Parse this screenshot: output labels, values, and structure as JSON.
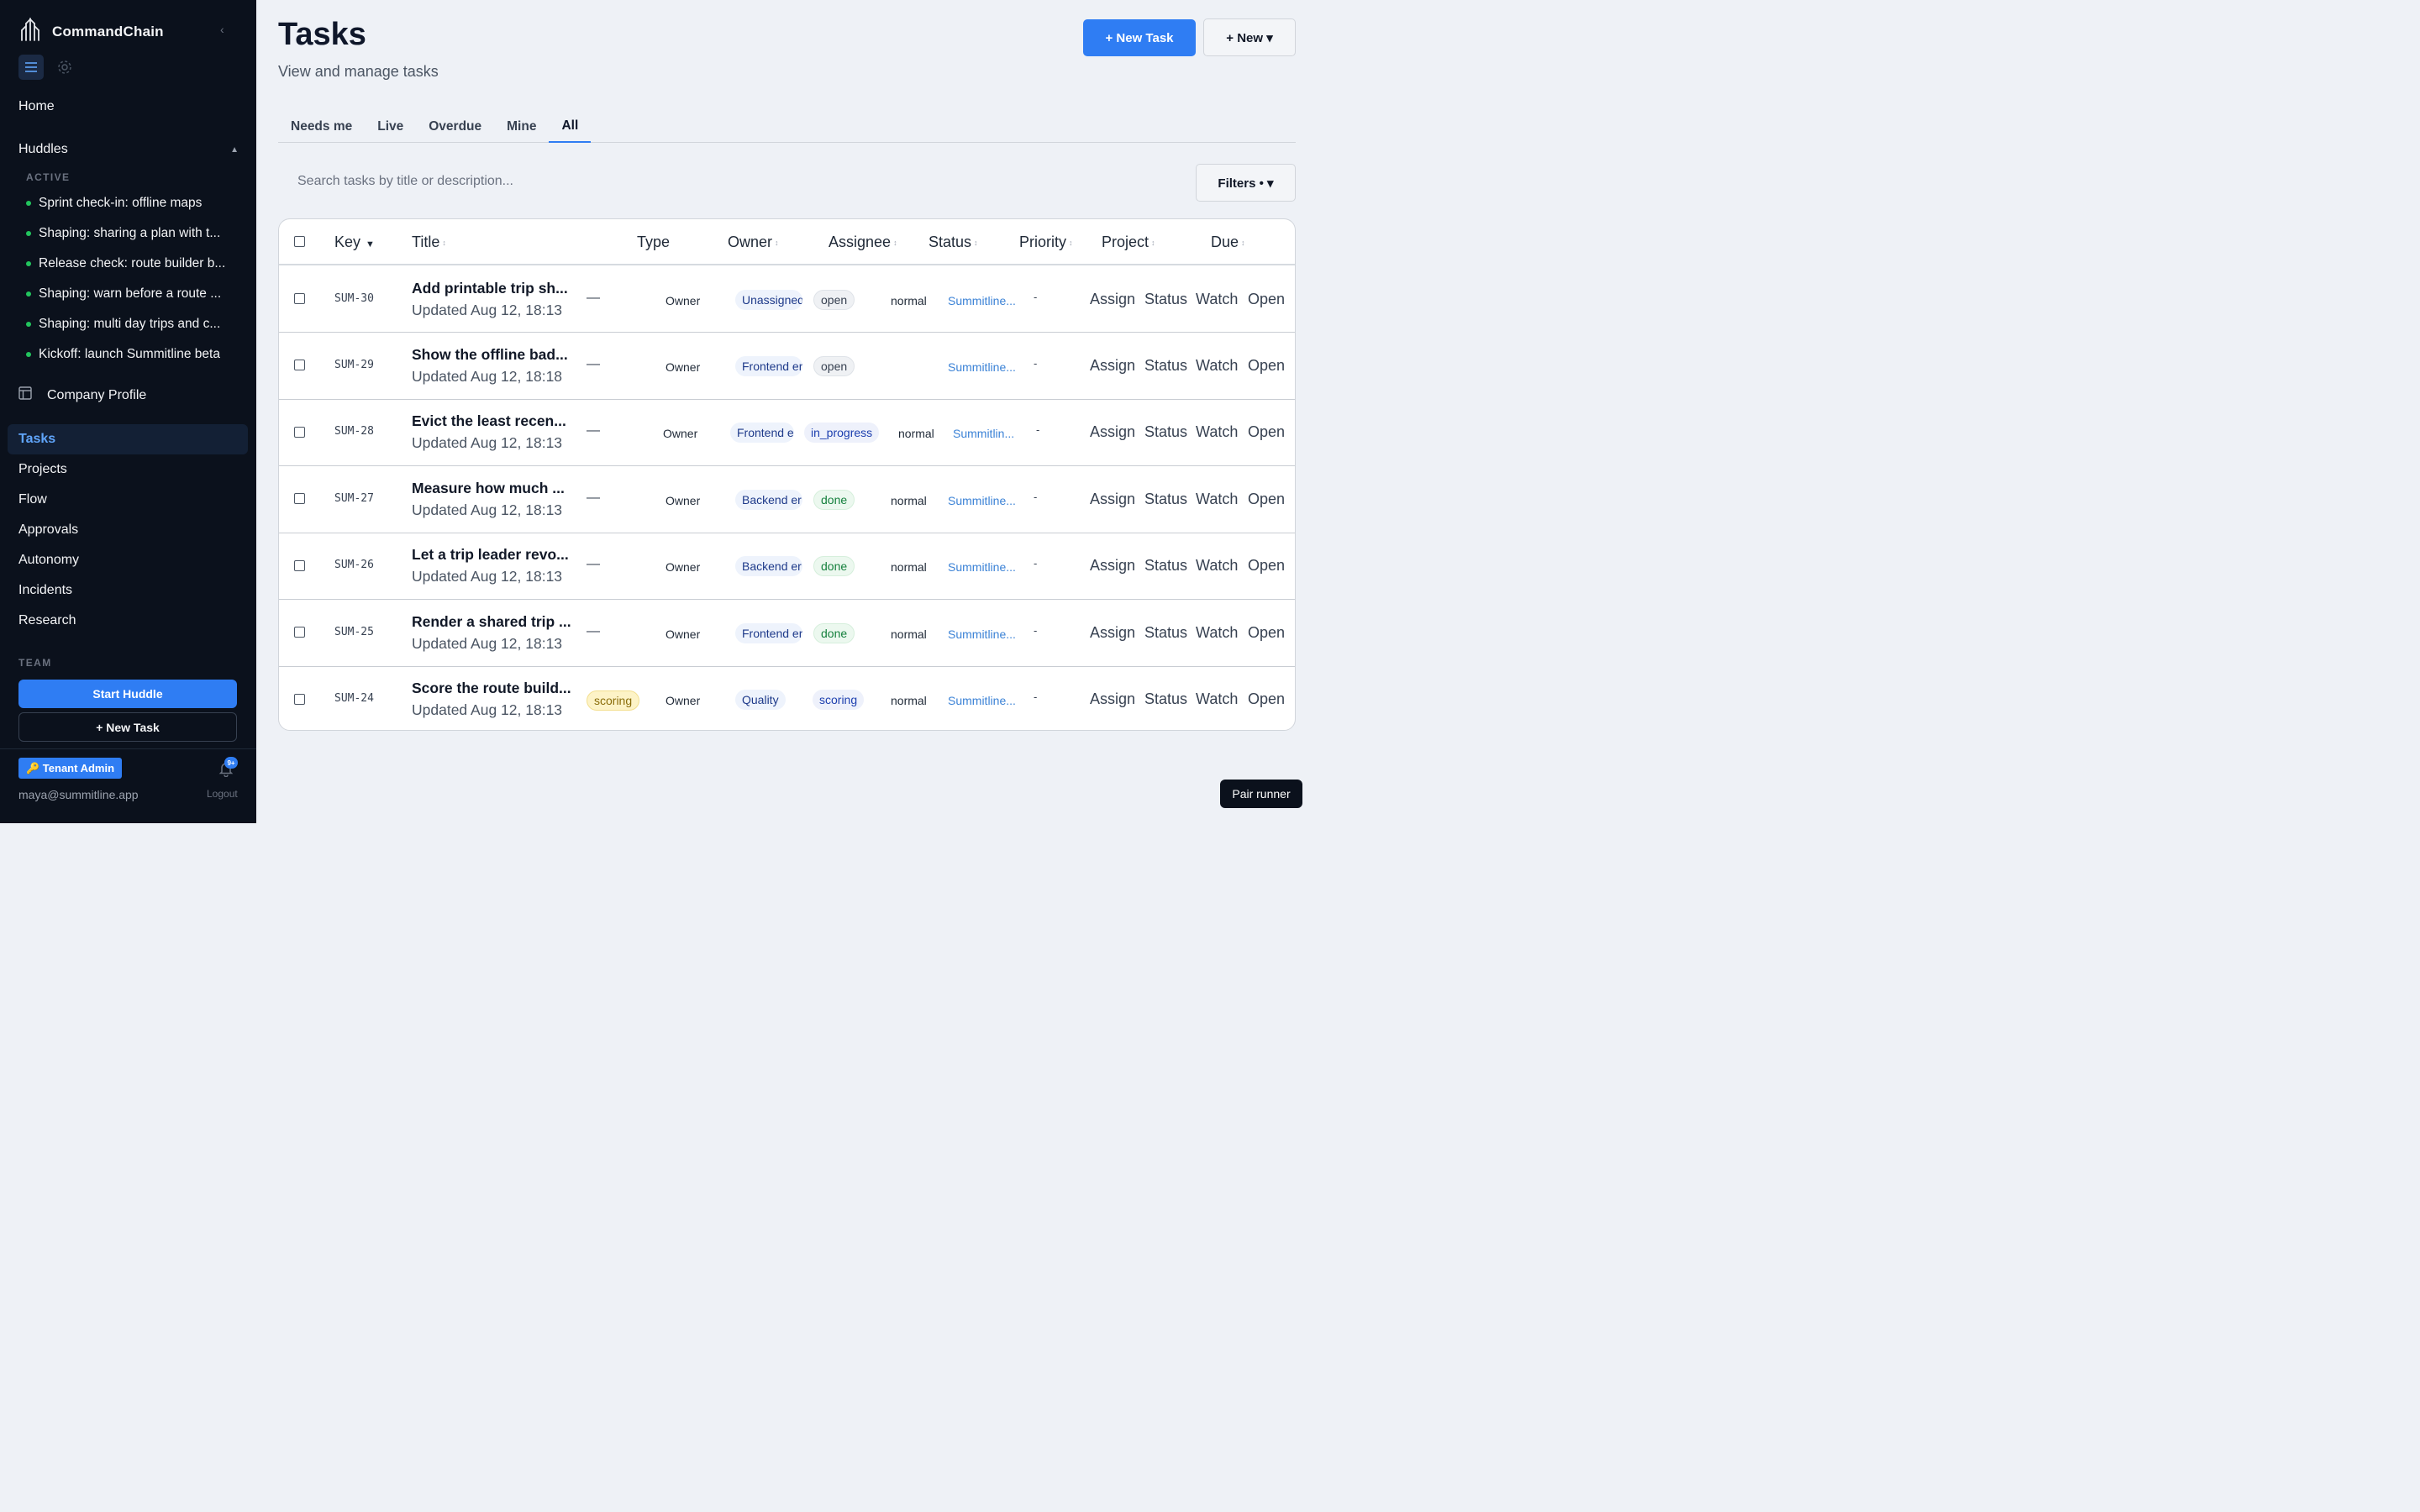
{
  "app": {
    "name": "CommandChain",
    "collapse_icon": "chevron-left-icon"
  },
  "sidebar": {
    "home": "Home",
    "huddles_label": "Huddles",
    "active_label": "ACTIVE",
    "huddles": [
      "Sprint check-in: offline maps",
      "Shaping: sharing a plan with t...",
      "Release check: route builder b...",
      "Shaping: warn before a route ...",
      "Shaping: multi day trips and c...",
      "Kickoff: launch Summitline beta"
    ],
    "company_profile": "Company Profile",
    "nav": [
      "Tasks",
      "Projects",
      "Flow",
      "Approvals",
      "Autonomy",
      "Incidents",
      "Research"
    ],
    "active_nav": "Tasks",
    "team_label": "TEAM",
    "start_huddle": "Start Huddle",
    "new_task": "+ New Task",
    "tenant_badge": "🔑 Tenant Admin",
    "notifications": "9+",
    "email": "maya@summitline.app",
    "logout": "Logout"
  },
  "header": {
    "title": "Tasks",
    "subtitle": "View and manage tasks",
    "new_task_button": "+ New Task",
    "new_button": "+ New ▾"
  },
  "tabs": [
    "Needs me",
    "Live",
    "Overdue",
    "Mine",
    "All"
  ],
  "active_tab": "All",
  "search": {
    "placeholder": "Search tasks by title or description..."
  },
  "filters_button": "Filters • ▾",
  "table": {
    "columns": [
      "Key",
      "Title",
      "Type",
      "Owner",
      "Assignee",
      "Status",
      "Priority",
      "Project",
      "Due"
    ],
    "actions": [
      "Assign",
      "Status",
      "Watch",
      "Open"
    ],
    "rows": [
      {
        "key": "SUM-30",
        "title": "Add printable trip sh...",
        "updated": "Updated Aug 12, 18:13",
        "type": "—",
        "owner": "Owner",
        "assignee": "Unassigned",
        "status": "open",
        "priority": "normal",
        "project": "Summitline...",
        "due": "-"
      },
      {
        "key": "SUM-29",
        "title": "Show the offline bad...",
        "updated": "Updated Aug 12, 18:18",
        "type": "—",
        "owner": "Owner",
        "assignee": "Frontend er",
        "status": "open",
        "priority": "",
        "project": "Summitline...",
        "due": "-"
      },
      {
        "key": "SUM-28",
        "title": "Evict the least recen...",
        "updated": "Updated Aug 12, 18:13",
        "type": "—",
        "owner": "Owner",
        "assignee": "Frontend e",
        "status": "in_progress",
        "priority": "normal",
        "project": "Summitlin...",
        "due": "-"
      },
      {
        "key": "SUM-27",
        "title": "Measure how much ...",
        "updated": "Updated Aug 12, 18:13",
        "type": "—",
        "owner": "Owner",
        "assignee": "Backend er",
        "status": "done",
        "priority": "normal",
        "project": "Summitline...",
        "due": "-"
      },
      {
        "key": "SUM-26",
        "title": "Let a trip leader revo...",
        "updated": "Updated Aug 12, 18:13",
        "type": "—",
        "owner": "Owner",
        "assignee": "Backend er",
        "status": "done",
        "priority": "normal",
        "project": "Summitline...",
        "due": "-"
      },
      {
        "key": "SUM-25",
        "title": "Render a shared trip ...",
        "updated": "Updated Aug 12, 18:13",
        "type": "—",
        "owner": "Owner",
        "assignee": "Frontend er",
        "status": "done",
        "priority": "normal",
        "project": "Summitline...",
        "due": "-"
      },
      {
        "key": "SUM-24",
        "title": "Score the route build...",
        "updated": "Updated Aug 12, 18:13",
        "type": "scoring",
        "owner": "Owner",
        "assignee": "Quality",
        "status": "scoring",
        "priority": "normal",
        "project": "Summitline...",
        "due": "-"
      }
    ]
  },
  "pair_runner": "Pair runner",
  "colors": {
    "accent": "#2f7df3",
    "sidebar_bg": "#0b111c",
    "status_dot": "#22c55e",
    "done": "#15803d",
    "project_link": "#3b82d6"
  }
}
